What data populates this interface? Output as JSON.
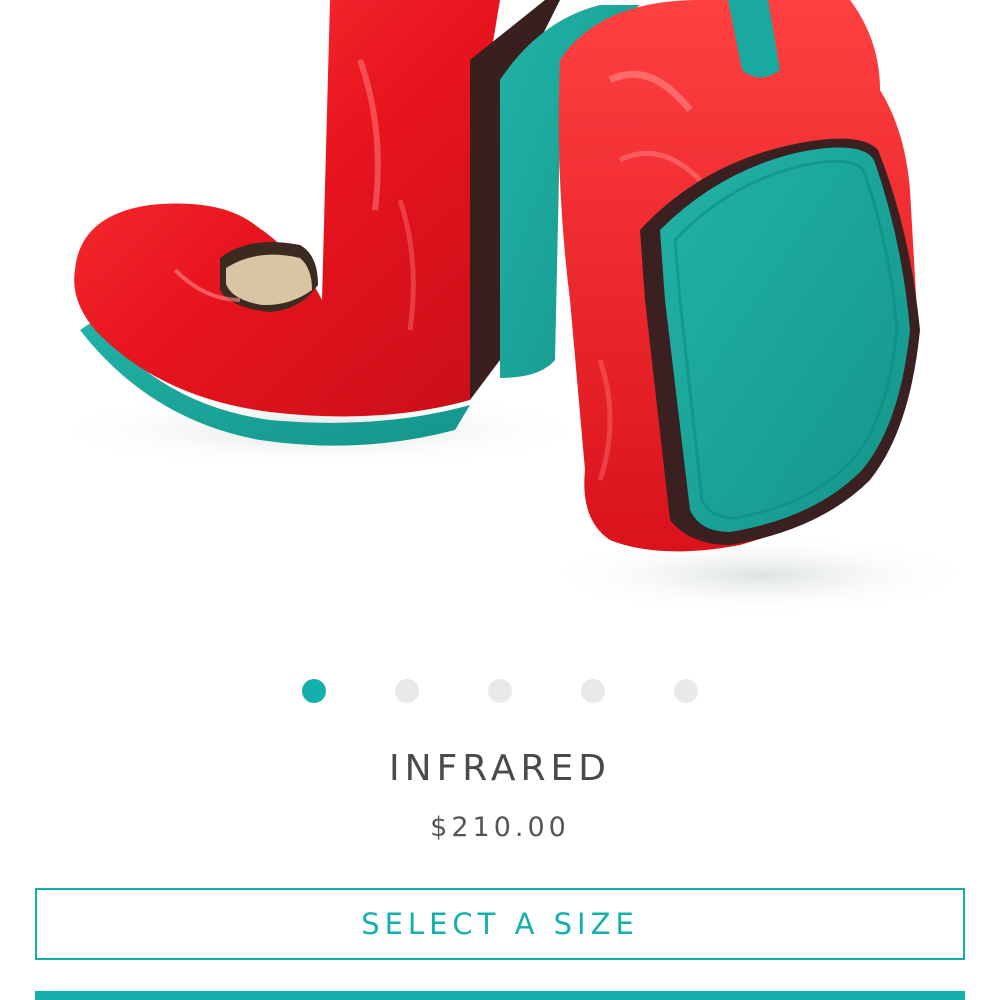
{
  "product": {
    "name": "INFRARED",
    "price": "$210.00",
    "image_icon": "ballet-flat-shoes-image"
  },
  "carousel": {
    "total": 5,
    "active_index": 0
  },
  "actions": {
    "select_size_label": "SELECT A SIZE"
  },
  "colors": {
    "accent": "#14b0ac",
    "shoe_red": "#e8202a",
    "sole_teal": "#1aa99e",
    "dot_inactive": "#e9e9e9",
    "text_dark": "#4a4a4a"
  }
}
